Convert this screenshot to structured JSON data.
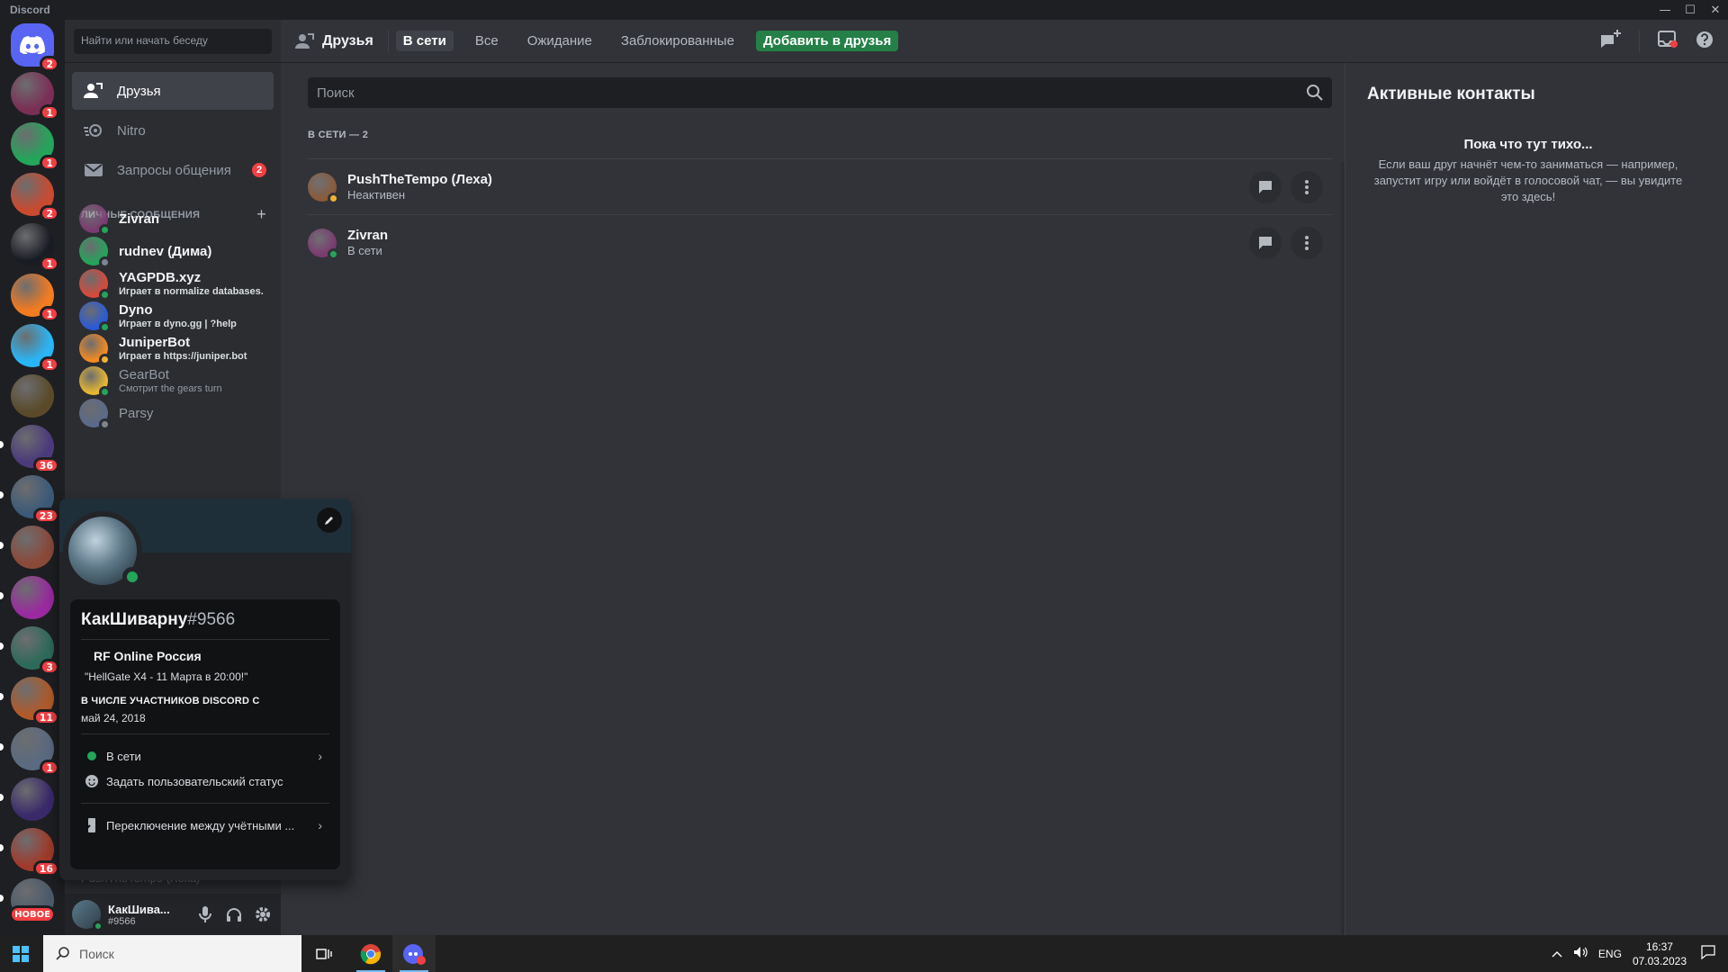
{
  "window": {
    "title": "Discord",
    "minimize": "—",
    "maximize": "☐",
    "close": "✕"
  },
  "servers": [
    {
      "id": "home",
      "badge": "2"
    },
    {
      "id": "s1",
      "badge": "1",
      "color": "#7a2f55"
    },
    {
      "id": "s2",
      "badge": "1",
      "color": "#23a55a"
    },
    {
      "id": "s3",
      "badge": "2",
      "color": "#c84a2f"
    },
    {
      "id": "s4",
      "badge": "1",
      "color": "#1a1c24"
    },
    {
      "id": "s5",
      "badge": "1",
      "color": "#f47b20"
    },
    {
      "id": "s6",
      "badge": "1",
      "color": "#29b6f6"
    },
    {
      "id": "s7",
      "badge": "",
      "color": "#5a4a2a"
    },
    {
      "id": "s8",
      "badge": "36",
      "color": "#4a3a7a"
    },
    {
      "id": "s9",
      "badge": "23",
      "color": "#3c5a78"
    },
    {
      "id": "s10",
      "badge": "",
      "color": "#8a4a3a"
    },
    {
      "id": "s11",
      "badge": "",
      "color": "#9a2aa0"
    },
    {
      "id": "s12",
      "badge": "3",
      "color": "#2e6a5a"
    },
    {
      "id": "s13",
      "badge": "11",
      "color": "#b05a2a"
    },
    {
      "id": "s14",
      "badge": "1",
      "color": "#5a6a80"
    },
    {
      "id": "s15",
      "badge": "",
      "color": "#3a2a6a"
    },
    {
      "id": "s16",
      "badge": "16",
      "color": "#a03a2a"
    },
    {
      "id": "s17",
      "badge": "",
      "color": "#4a5a6a"
    }
  ],
  "new_badge": "НОВОЕ",
  "sidebar": {
    "search_placeholder": "Найти или начать беседу",
    "nav": [
      {
        "label": "Друзья"
      },
      {
        "label": "Nitro"
      },
      {
        "label": "Запросы общения",
        "badge": "2"
      }
    ],
    "dm_header": "ЛИЧНЫЕ СООБЩЕНИЯ",
    "dm_add": "+",
    "dms": [
      {
        "name": "Zivran",
        "sub": "",
        "color": "#7a3a70",
        "status": "online"
      },
      {
        "name": "rudnev (Дима)",
        "sub": "",
        "color": "#23a55a",
        "status": "off"
      },
      {
        "name": "YAGPDB.xyz",
        "sub": "Играет в normalize databases.",
        "color": "#d84a3a",
        "status": "online"
      },
      {
        "name": "Dyno",
        "sub": "Играет в dyno.gg | ?help",
        "color": "#2a5ad8",
        "status": "online"
      },
      {
        "name": "JuniperBot",
        "sub": "Играет в https://juniper.bot",
        "color": "#f48a20",
        "status": "idle"
      },
      {
        "name": "GearBot",
        "sub": "Смотрит the gears turn",
        "color": "#e8b830",
        "status": "online"
      },
      {
        "name": "Parsy",
        "sub": "",
        "color": "#5a6a8a",
        "status": "off"
      }
    ],
    "behind_text": "PushTheTempo (Леха)"
  },
  "user": {
    "name": "КакШива...",
    "tag": "#9566"
  },
  "header": {
    "title": "Друзья",
    "tabs": [
      "В сети",
      "Все",
      "Ожидание",
      "Заблокированные"
    ],
    "add_friend": "Добавить в друзья"
  },
  "main": {
    "search_placeholder": "Поиск",
    "online_count": "В СЕТИ — 2",
    "friends": [
      {
        "name": "PushTheTempo (Леха)",
        "status": "Неактивен",
        "state": "idle",
        "color": "#8a5a3a"
      },
      {
        "name": "Zivran",
        "status": "В сети",
        "state": "online",
        "color": "#7a3a70"
      }
    ]
  },
  "active_now": {
    "title": "Активные контакты",
    "quiet": "Пока что тут тихо...",
    "desc": "Если ваш друг начнёт чем-то заниматься — например, запустит игру или войдёт в голосовой чат, — вы увидите это здесь!"
  },
  "popout": {
    "name": "КакШиварну",
    "tag": "#9566",
    "server_name": "RF Online Россия",
    "server_quote": "\"HellGate X4 - 11 Марта в 20:00!\"",
    "member_label": "В ЧИСЛЕ УЧАСТНИКОВ DISCORD С",
    "member_date": "май 24, 2018",
    "status": "В сети",
    "custom_status": "Задать пользовательский статус",
    "switch_accounts": "Переключение между учётными ..."
  },
  "taskbar": {
    "search_placeholder": "Поиск",
    "lang": "ENG",
    "time": "16:37",
    "date": "07.03.2023"
  },
  "colors": {
    "accent": "#5865f2",
    "online": "#23a55a",
    "idle": "#f0b232",
    "danger": "#f23f43",
    "add_friend": "#248046"
  }
}
